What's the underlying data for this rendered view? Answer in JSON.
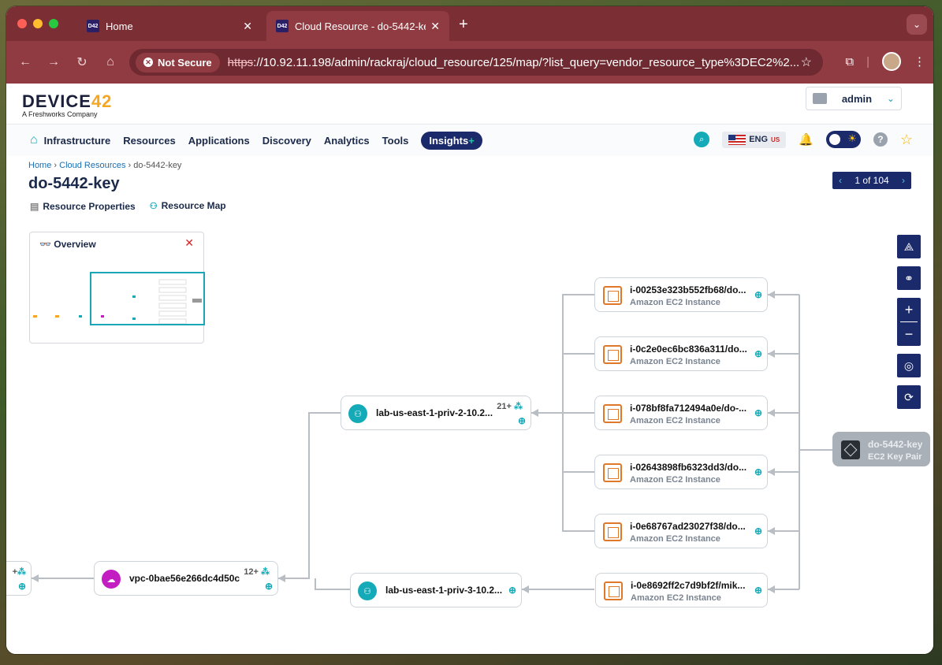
{
  "browser": {
    "tabs": [
      {
        "title": "Home",
        "favicon": "D42"
      },
      {
        "title": "Cloud Resource - do-5442-key",
        "favicon": "D42"
      }
    ],
    "new_tab": "+",
    "not_secure": "Not Secure",
    "url_scheme": "https",
    "url_rest": "://10.92.11.198/admin/rackraj/cloud_resource/125/map/?list_query=vendor_resource_type%3DEC2%2..."
  },
  "app": {
    "logo_main_a": "DEVIC",
    "logo_main_b": "E",
    "logo_main_c": "42",
    "logo_sub": "A Freshworks Company",
    "user": "admin",
    "lang": "ENG",
    "lang_region": "US"
  },
  "nav": {
    "items": [
      "Infrastructure",
      "Resources",
      "Applications",
      "Discovery",
      "Analytics",
      "Tools"
    ],
    "insights": "Insights",
    "insights_plus": "+"
  },
  "page": {
    "breadcrumb": [
      "Home",
      "Cloud Resources",
      "do-5442-key"
    ],
    "title": "do-5442-key",
    "pager": "1 of 104",
    "tabs": [
      "Resource Properties",
      "Resource Map"
    ]
  },
  "overview": {
    "title": "Overview"
  },
  "map": {
    "instances": [
      {
        "name": "i-00253e323b552fb68/do...",
        "type": "Amazon EC2 Instance"
      },
      {
        "name": "i-0c2e0ec6bc836a311/do...",
        "type": "Amazon EC2 Instance"
      },
      {
        "name": "i-078bf8fa712494a0e/do-...",
        "type": "Amazon EC2 Instance"
      },
      {
        "name": "i-02643898fb6323dd3/do...",
        "type": "Amazon EC2 Instance"
      },
      {
        "name": "i-0e68767ad23027f38/do...",
        "type": "Amazon EC2 Instance"
      },
      {
        "name": "i-0e8692ff2c7d9bf2f/mik...",
        "type": "Amazon EC2 Instance"
      }
    ],
    "subnet_a": {
      "name": "lab-us-east-1-priv-2-10.2...",
      "count": "21+"
    },
    "subnet_b": {
      "name": "lab-us-east-1-priv-3-10.2..."
    },
    "vpc": {
      "name": "vpc-0bae56e266dc4d50c",
      "count": "12+"
    },
    "left_count": "+",
    "key": {
      "name": "do-5442-key",
      "type": "EC2 Key Pair"
    }
  }
}
